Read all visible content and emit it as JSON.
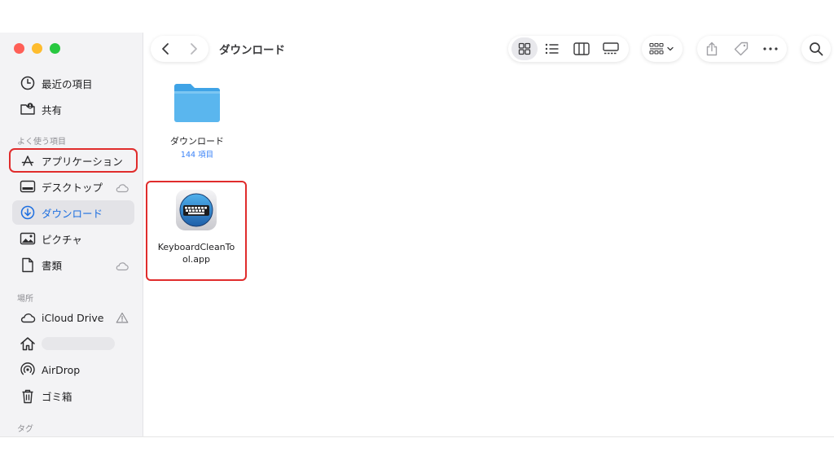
{
  "window": {
    "title": "ダウンロード"
  },
  "sidebar": {
    "top_items": [
      {
        "label": "最近の項目",
        "icon": "clock-icon"
      },
      {
        "label": "共有",
        "icon": "shared-folder-icon"
      }
    ],
    "favorites_title": "よく使う項目",
    "favorites": [
      {
        "label": "アプリケーション",
        "icon": "applications-icon",
        "highlighted": true
      },
      {
        "label": "デスクトップ",
        "icon": "desktop-icon",
        "cloud": true
      },
      {
        "label": "ダウンロード",
        "icon": "downloads-icon",
        "selected": true
      },
      {
        "label": "ピクチャ",
        "icon": "pictures-icon"
      },
      {
        "label": "書類",
        "icon": "documents-icon",
        "cloud": true
      }
    ],
    "locations_title": "場所",
    "locations": [
      {
        "label": "iCloud Drive",
        "icon": "cloud-icon",
        "warning": true
      },
      {
        "label": "",
        "icon": "home-icon",
        "blurred": true
      },
      {
        "label": "AirDrop",
        "icon": "airdrop-icon"
      },
      {
        "label": "ゴミ箱",
        "icon": "trash-icon"
      }
    ],
    "tags_title": "タグ"
  },
  "toolbar": {
    "view_icons": [
      "grid-view-icon",
      "list-view-icon",
      "column-view-icon",
      "gallery-view-icon"
    ],
    "group_icon": "group-by-icon",
    "action_icons": [
      "share-icon",
      "tag-icon",
      "more-icon"
    ],
    "search_icon": "search-icon"
  },
  "content": {
    "items": [
      {
        "name": "ダウンロード",
        "count": "144 項目",
        "kind": "folder"
      },
      {
        "name_line1": "KeyboardCleanTo",
        "name_line2": "ol.app",
        "kind": "app",
        "highlighted": true
      }
    ]
  },
  "colors": {
    "accent": "#1d6fe0",
    "highlight": "#e02c2c",
    "folder": "#5ab6ee",
    "sidebar_bg": "#f3f3f5"
  }
}
